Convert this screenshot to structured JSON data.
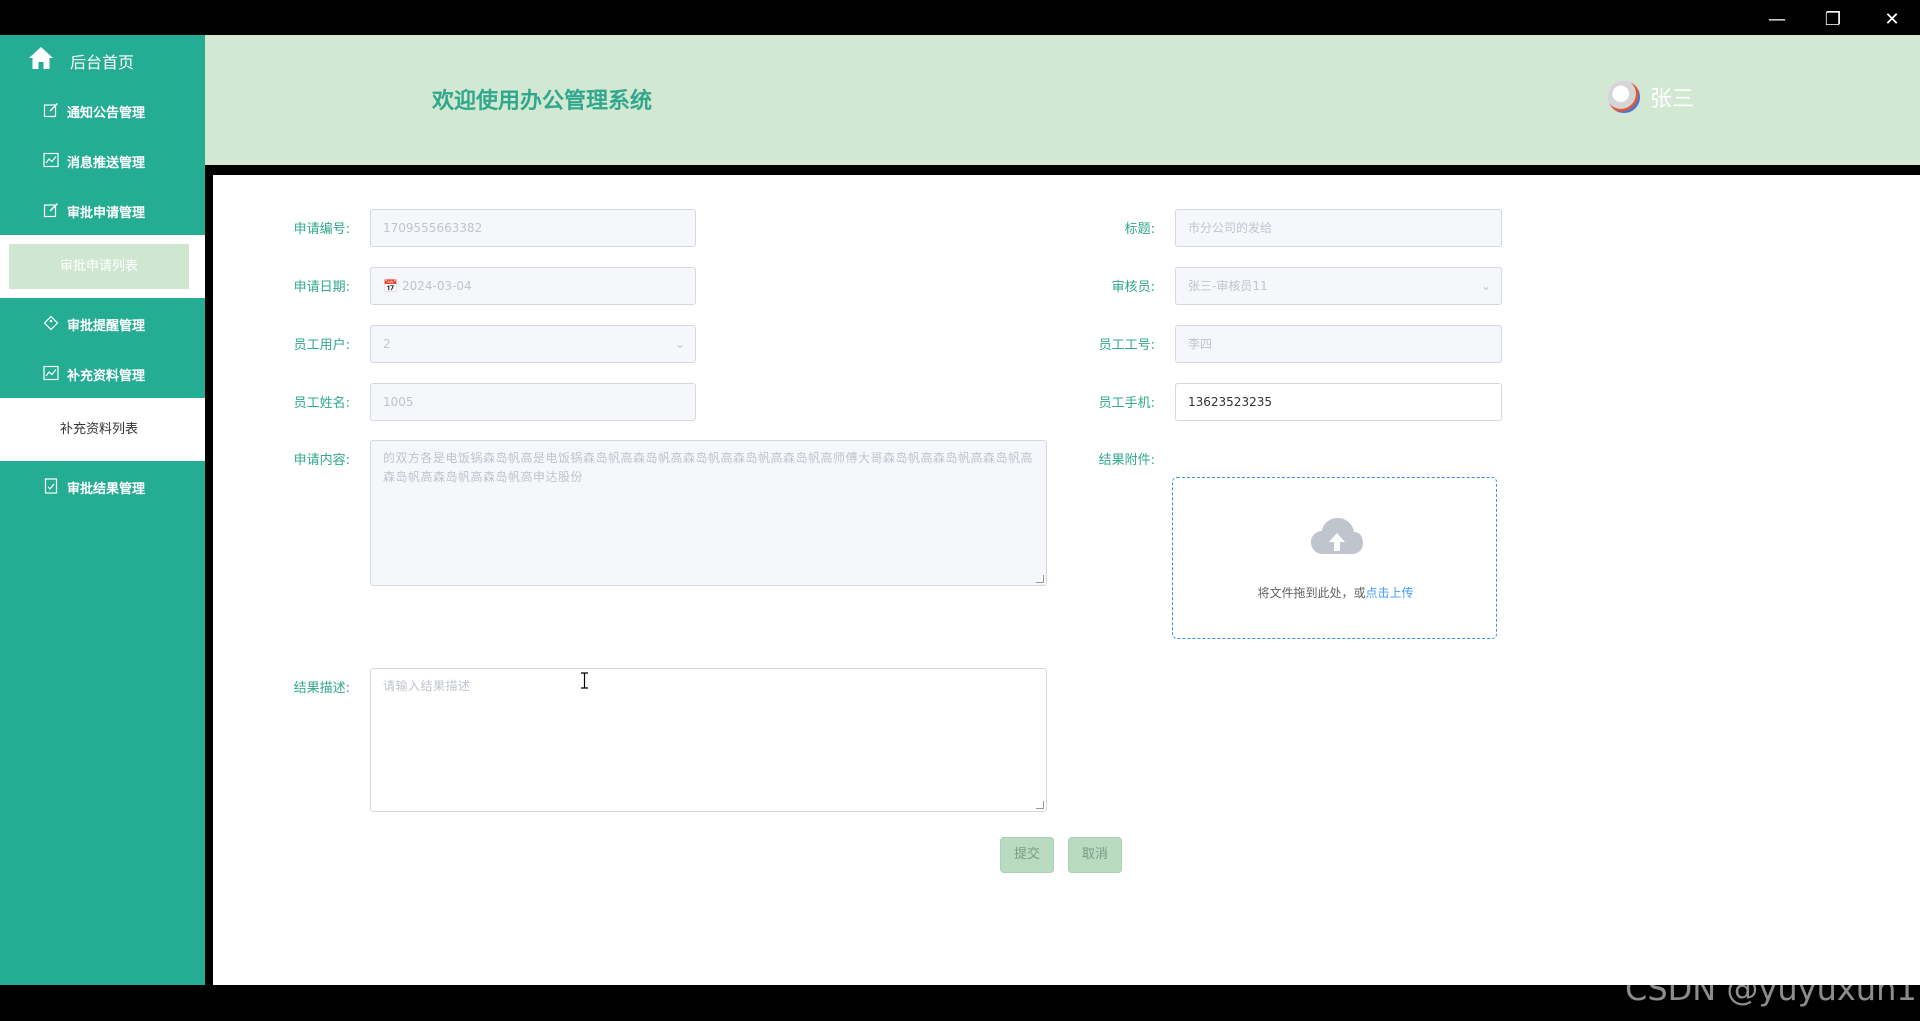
{
  "sidebar": {
    "home_label": "后台首页",
    "items": [
      {
        "label": "通知公告管理",
        "icon": "edit-icon"
      },
      {
        "label": "消息推送管理",
        "icon": "chart-icon"
      },
      {
        "label": "审批申请管理",
        "icon": "edit-icon"
      },
      {
        "label": "审批申请列表",
        "sub": true,
        "active": true
      },
      {
        "label": "审批提醒管理",
        "icon": "tag-icon"
      },
      {
        "label": "补充资料管理",
        "icon": "chart-icon"
      },
      {
        "label": "补充资料列表",
        "sub": true,
        "active": false
      },
      {
        "label": "审批结果管理",
        "icon": "document-icon"
      }
    ]
  },
  "header": {
    "title": "欢迎使用办公管理系统",
    "username": "张三"
  },
  "form": {
    "apply_no": {
      "label": "申请编号:",
      "value": "1709555663382"
    },
    "title": {
      "label": "标题:",
      "value": "市分公司的发给"
    },
    "apply_date": {
      "label": "申请日期:",
      "value": "2024-03-04"
    },
    "reviewer": {
      "label": "审核员:",
      "value": "张三-审核员11"
    },
    "employee_user": {
      "label": "员工用户:",
      "value": "2"
    },
    "employee_no": {
      "label": "员工工号:",
      "value": "李四"
    },
    "employee_name": {
      "label": "员工姓名:",
      "value": "1005"
    },
    "employee_phone": {
      "label": "员工手机:",
      "value": "13623523235"
    },
    "content": {
      "label": "申请内容:",
      "value": "的双方各是电饭锅森岛帆高是电饭锅森岛帆高森岛帆高森岛帆高森岛帆高森岛帆高师傅大哥森岛帆高森岛帆高森岛帆高森岛帆高森岛帆高森岛帆高申达股份"
    },
    "attachment": {
      "label": "结果附件:",
      "upload_text": "将文件拖到此处，或",
      "upload_link": "点击上传"
    },
    "result_desc": {
      "label": "结果描述:",
      "placeholder": "请输入结果描述"
    }
  },
  "buttons": {
    "submit": "提交",
    "cancel": "取消"
  },
  "watermark": "CSDN @yuyuxun1",
  "colors": {
    "sidebar": "#24ad93",
    "header": "#d2e8d3",
    "accent": "#2fa88c",
    "button": "#b9dcc0",
    "link": "#409eff"
  }
}
